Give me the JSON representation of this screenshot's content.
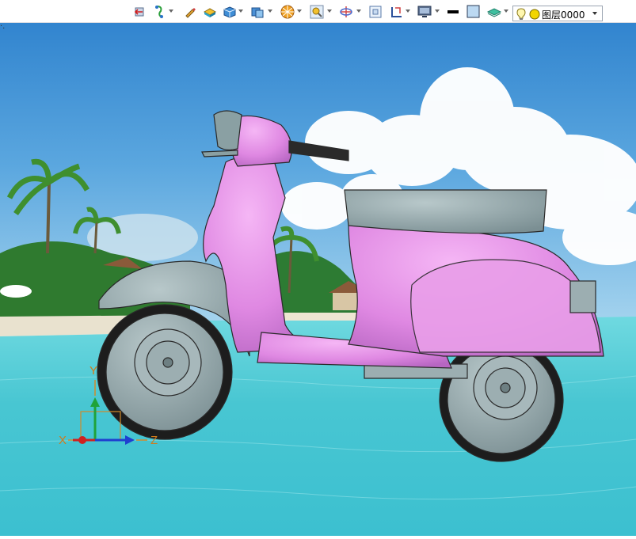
{
  "toolbar": {
    "buttons": [
      {
        "name": "undo-arrow-icon",
        "has_dropdown": false
      },
      {
        "name": "snap-tool-icon",
        "has_dropdown": true
      },
      {
        "name": "pencil-icon",
        "has_dropdown": false
      },
      {
        "name": "flat-shade-icon",
        "has_dropdown": false
      },
      {
        "name": "cube-icon",
        "has_dropdown": true
      },
      {
        "name": "view-cube-icon",
        "has_dropdown": true
      },
      {
        "name": "render-mode-icon",
        "has_dropdown": true
      },
      {
        "name": "zoom-icon",
        "has_dropdown": true
      },
      {
        "name": "rotate-axis-icon",
        "has_dropdown": true
      },
      {
        "name": "frame-icon",
        "has_dropdown": false
      },
      {
        "name": "section-icon",
        "has_dropdown": true
      },
      {
        "name": "monitor-icon",
        "has_dropdown": true
      },
      {
        "name": "line-weight-icon",
        "has_dropdown": false
      },
      {
        "name": "fill-color-icon",
        "has_dropdown": false
      },
      {
        "name": "layer-style-icon",
        "has_dropdown": true
      }
    ],
    "layer": {
      "label": "图层0000",
      "bulb_icon": "lightbulb-icon",
      "color_icon": "layer-color-icon",
      "color": "#f2d500"
    }
  },
  "triad": {
    "x_label": "X",
    "y_label": "Y",
    "z_label": "Z"
  },
  "scene": {
    "sky_color": "#4f9ed8",
    "sea_color": "#55d3da",
    "scooter_body_color": "#e48fe6",
    "scooter_parts_color": "#9bafb2"
  }
}
